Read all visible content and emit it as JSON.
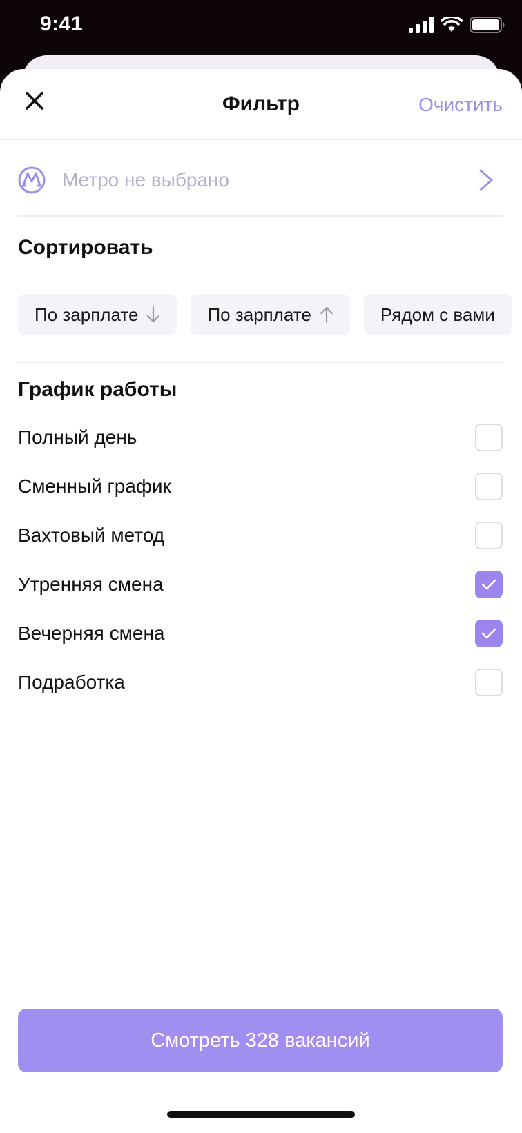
{
  "status": {
    "time": "9:41"
  },
  "header": {
    "title": "Фильтр",
    "clear_label": "Очистить"
  },
  "metro": {
    "placeholder": "Метро не выбрано",
    "icon": "metro-icon"
  },
  "sort": {
    "title": "Сортировать",
    "options": [
      {
        "label": "По зарплате",
        "arrow": "down"
      },
      {
        "label": "По зарплате",
        "arrow": "up"
      },
      {
        "label": "Рядом с вами",
        "arrow": ""
      }
    ]
  },
  "schedule": {
    "title": "График работы",
    "options": [
      {
        "label": "Полный день",
        "checked": false
      },
      {
        "label": "Сменный график",
        "checked": false
      },
      {
        "label": "Вахтовый метод",
        "checked": false
      },
      {
        "label": "Утренняя смена",
        "checked": true
      },
      {
        "label": "Вечерняя смена",
        "checked": true
      },
      {
        "label": "Подработка",
        "checked": false
      }
    ]
  },
  "cta": {
    "label": "Смотреть 328 вакансий"
  },
  "colors": {
    "accent": "#9a86ec",
    "accent_light": "#a08ff0",
    "placeholder": "#b6b0c8"
  }
}
